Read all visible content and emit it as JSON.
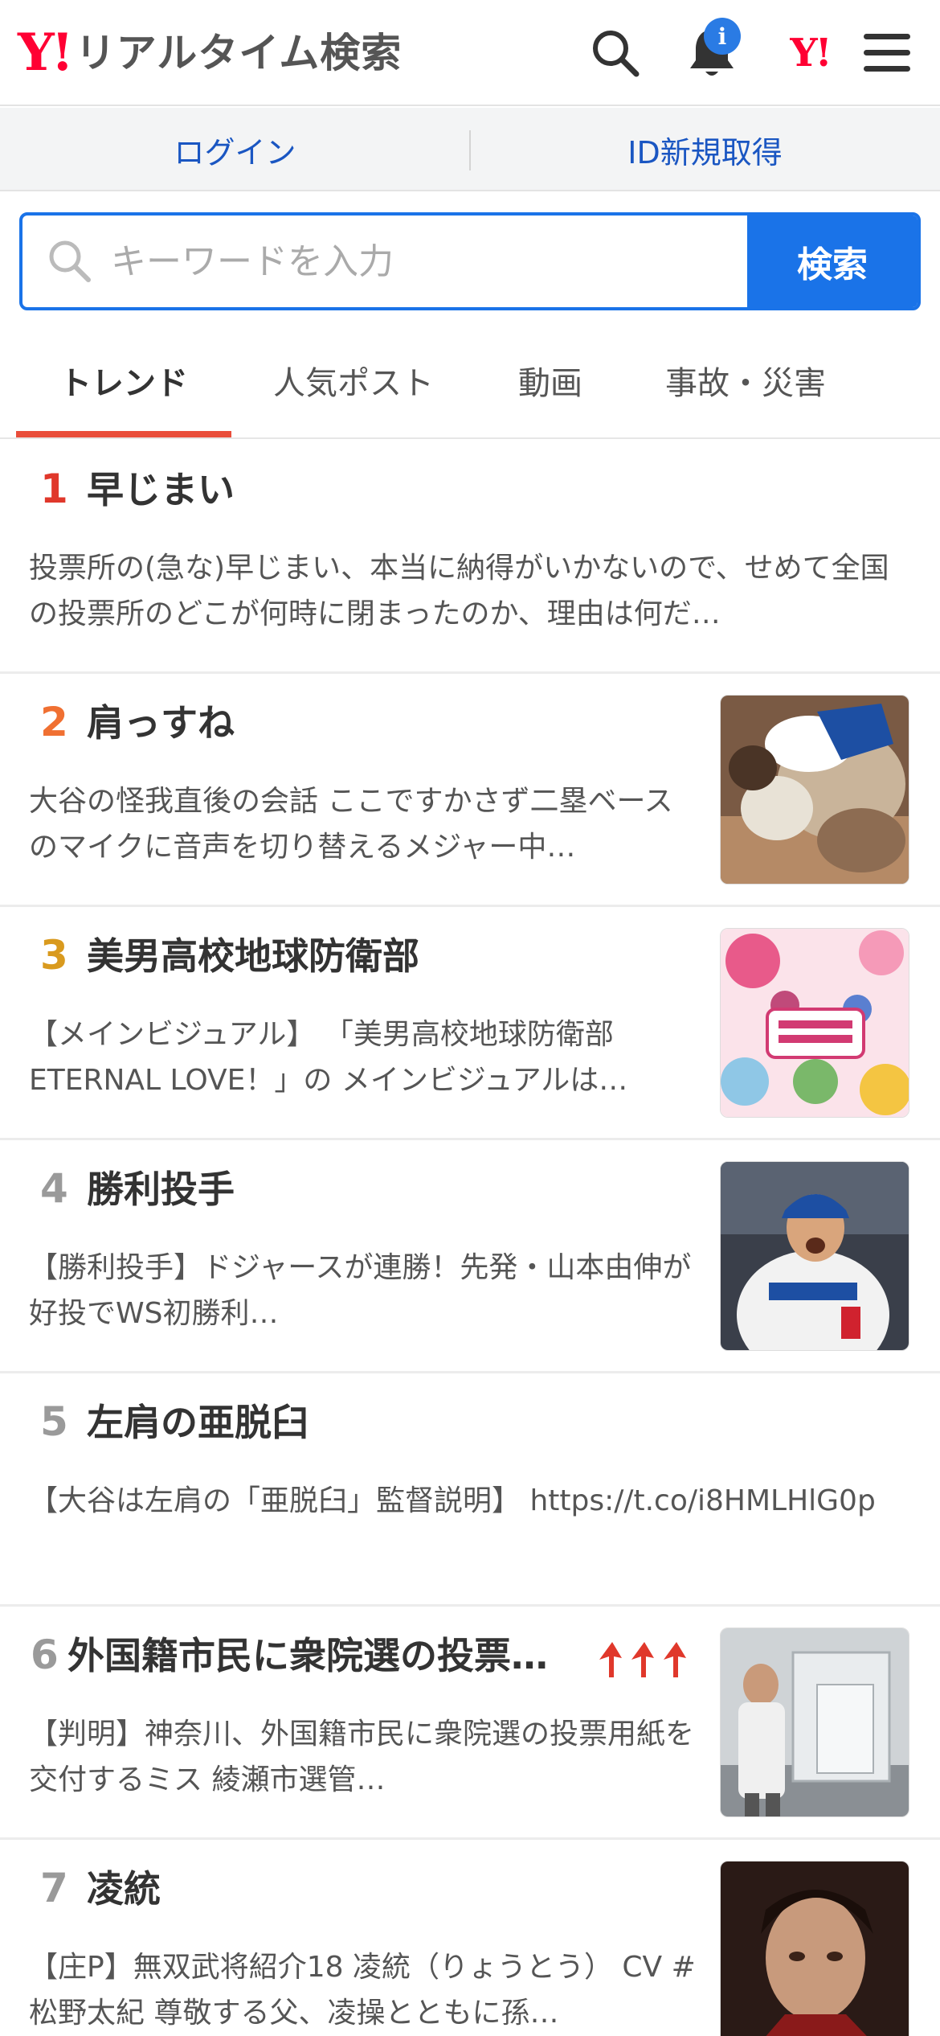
{
  "header": {
    "logo_mark": "Y!",
    "logo_text": "リアルタイム検索",
    "notification_badge": "i",
    "yahoo_mini": "Y!"
  },
  "auth": {
    "login": "ログイン",
    "signup": "ID新規取得"
  },
  "search": {
    "placeholder": "キーワードを入力",
    "button": "検索"
  },
  "tabs": [
    {
      "label": "トレンド",
      "active": true
    },
    {
      "label": "人気ポスト",
      "active": false
    },
    {
      "label": "動画",
      "active": false
    },
    {
      "label": "事故・災害",
      "active": false
    }
  ],
  "colors": {
    "brand_red": "#ff0033",
    "accent_blue": "#1a73e8",
    "tab_indicator": "#e94e3b",
    "rank_1": "#e0382b",
    "rank_2": "#f07032",
    "rank_3": "#d99a1e",
    "rank_other": "#9a9a9a"
  },
  "trends": [
    {
      "rank": "1",
      "title": "早じまい",
      "description": "投票所の(急な)早じまい、本当に納得がいかないので、せめて全国の投票所のどこが何時に閉まったのか、理由は何だ…",
      "has_image": false,
      "image_icon": ""
    },
    {
      "rank": "2",
      "title": "肩っすね",
      "description": "大谷の怪我直後の会話 ここですかさず二塁ベースのマイクに音声を切り替えるメジャー中…",
      "has_image": true,
      "image_icon": "baseball-player-injury-photo"
    },
    {
      "rank": "3",
      "title": "美男高校地球防衛部",
      "description": "【メインビジュアル】 「美男高校地球防衛部ETERNAL LOVE！」の メインビジュアルは…",
      "has_image": true,
      "image_icon": "anime-key-visual-image"
    },
    {
      "rank": "4",
      "title": "勝利投手",
      "description": "【勝利投手】ドジャースが連勝！先発・山本由伸が好投でWS初勝利…",
      "has_image": true,
      "image_icon": "dodgers-pitcher-photo"
    },
    {
      "rank": "5",
      "title": "左肩の亜脱臼",
      "description": "【大谷は左肩の「亜脱臼」監督説明】 https://t.co/i8HMLHlG0p",
      "has_image": false,
      "image_icon": ""
    },
    {
      "rank": "6",
      "title": "外国籍市民に衆院選の投票…",
      "description": "【判明】神奈川、外国籍市民に衆院選の投票用紙を交付するミス 綾瀬市選管…",
      "has_image": true,
      "image_icon": "voting-booth-photo",
      "trending_arrows": true
    },
    {
      "rank": "7",
      "title": "凌統",
      "description": "【庄P】無双武将紹介18 凌統（りょうとう） CV #松野太紀 尊敬する父、凌操とともに孫…",
      "has_image": true,
      "image_icon": "game-character-portrait"
    }
  ]
}
